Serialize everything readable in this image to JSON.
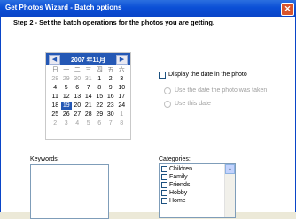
{
  "window": {
    "title": "Get Photos Wizard - Batch options",
    "close_glyph": "✕"
  },
  "step_text": "Step 2 - Set the batch operations for the photos you are getting.",
  "calendar": {
    "header": "2007 年11月",
    "prev_glyph": "◀",
    "next_glyph": "▶",
    "weekdays": [
      "日",
      "一",
      "二",
      "三",
      "四",
      "五",
      "六"
    ],
    "weeks": [
      [
        "28",
        "29",
        "30",
        "31",
        "1",
        "2",
        "3"
      ],
      [
        "4",
        "5",
        "6",
        "7",
        "8",
        "9",
        "10"
      ],
      [
        "11",
        "12",
        "13",
        "14",
        "15",
        "16",
        "17"
      ],
      [
        "18",
        "19",
        "20",
        "21",
        "22",
        "23",
        "24"
      ],
      [
        "25",
        "26",
        "27",
        "28",
        "29",
        "30",
        "1"
      ],
      [
        "2",
        "3",
        "4",
        "5",
        "6",
        "7",
        "8"
      ]
    ],
    "selected_day": "19"
  },
  "options": {
    "display_date": "Display the date in the photo",
    "use_taken": "Use the date the photo was taken",
    "use_this": "Use this date"
  },
  "keywords_label": "Keywords:",
  "categories_label": "Categories:",
  "categories": [
    "Children",
    "Family",
    "Friends",
    "Hobby",
    "Home"
  ]
}
